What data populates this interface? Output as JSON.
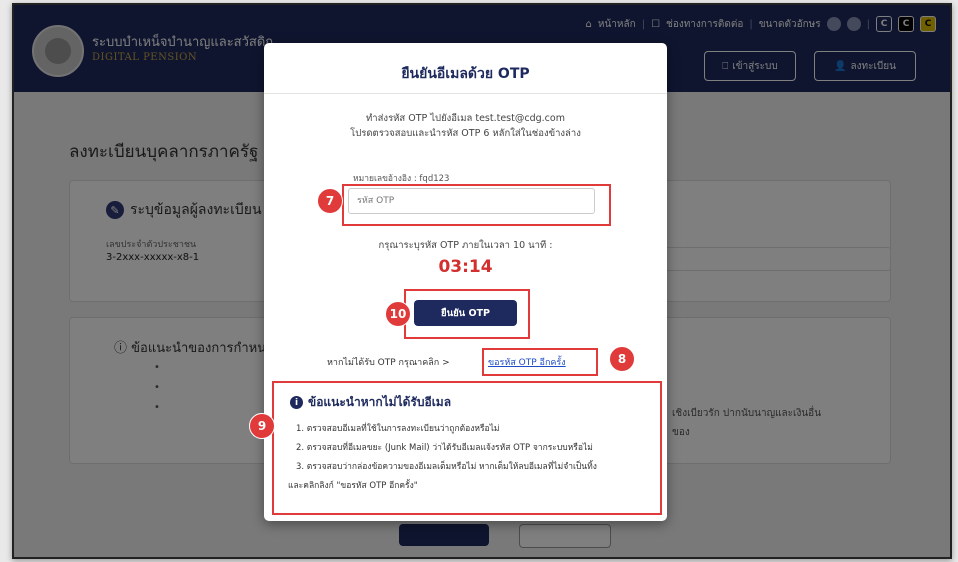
{
  "header": {
    "title": "ระบบบำเหน็จบำนาญและสวัสดิก",
    "subtitle": "DIGITAL PENSION",
    "nav_home": "หน้าหลัก",
    "nav_contact": "ช่องทางการติดต่อ",
    "nav_font_size": "ขนาดตัวอักษร",
    "contrast_labels": [
      "C",
      "C",
      "C"
    ],
    "login_btn": "เข้าสู่ระบบ",
    "register_btn": "ลงทะเบียน"
  },
  "page": {
    "title": "ลงทะเบียนบุคลากรภาครัฐ",
    "section_title": "ระบุข้อมูลผู้ลงทะเบียน",
    "id_label": "เลขประจำตัวประชาชน",
    "id_value": "3-2xxx-xxxxx-x8-1",
    "advice_title": "ข้อแนะนำของการกำหน",
    "advice_right_1": "เชิงเบียวรัก ปากนับนาญและเงินอื่น",
    "advice_right_2": "ของ"
  },
  "modal": {
    "title": "ยืนยันอีเมลด้วย OTP",
    "message_line1": "ทำส่งรหัส OTP ไปยังอีเมล test.test@cdg.com",
    "message_line2": "โปรดตรวจสอบและนำรหัส OTP 6 หลักใส่ในช่องข้างล่าง",
    "ref_code": "หมายเลขอ้างอิง : fqd123",
    "otp_placeholder": "รหัส OTP",
    "timer_label": "กรุณาระบุรหัส OTP ภายในเวลา 10 นาที :",
    "timer_value": "03:14",
    "confirm_button": "ยืนยัน OTP",
    "resend_prompt": "หากไม่ได้รับ OTP กรุณาคลิก >",
    "resend_link": "ขอรหัส OTP อีกครั้ง",
    "info_title": "ข้อแนะนำหากไม่ได้รับอีเมล",
    "info_lines": [
      "1. ตรวจสอบอีเมลที่ใช้ในการลงทะเบียนว่าถูกต้องหรือไม่",
      "2. ตรวจสอบที่อีเมลขยะ (Junk Mail) ว่าได้รับอีเมลแจ้งรหัส OTP จากระบบหรือไม่",
      "3. ตรวจสอบว่ากล่องข้อความของอีเมลเต็มหรือไม่ หากเต็มให้ลบอีเมลที่ไม่จำเป็นทิ้ง",
      "และคลิกลิงก์ \"ขอรหัส OTP อีกครั้ง\""
    ]
  },
  "markers": {
    "otp_input": "7",
    "resend": "8",
    "info": "9",
    "confirm": "10"
  },
  "colors": {
    "navy": "#1e2a5e",
    "highlight": "#e03a3a",
    "timer": "#d32f2f",
    "link": "#1f4cc4"
  }
}
